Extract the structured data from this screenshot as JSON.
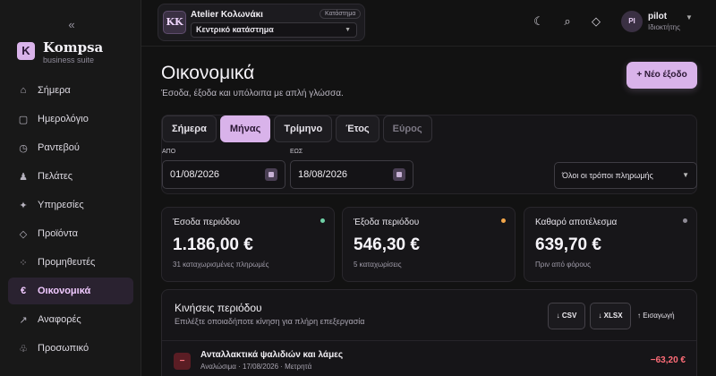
{
  "sidebar": {
    "collapse_glyph": "«",
    "brand": {
      "name": "Kompsa",
      "subtitle": "business suite",
      "logo_letter": "K"
    },
    "items": [
      {
        "label": "Σήμερα",
        "icon": "home-icon",
        "glyph": "⌂"
      },
      {
        "label": "Ημερολόγιο",
        "icon": "calendar-icon",
        "glyph": "▢"
      },
      {
        "label": "Ραντεβού",
        "icon": "clock-icon",
        "glyph": "◷"
      },
      {
        "label": "Πελάτες",
        "icon": "person-icon",
        "glyph": "♟"
      },
      {
        "label": "Υπηρεσίες",
        "icon": "sparkle-icon",
        "glyph": "✦"
      },
      {
        "label": "Προϊόντα",
        "icon": "diamond-icon",
        "glyph": "◇"
      },
      {
        "label": "Προμηθευτές",
        "icon": "dots-icon",
        "glyph": "⁘"
      },
      {
        "label": "Οικονομικά",
        "icon": "euro-icon",
        "glyph": "€",
        "active": true
      },
      {
        "label": "Αναφορές",
        "icon": "trend-arrow-icon",
        "glyph": "↗"
      },
      {
        "label": "Προσωπικό",
        "icon": "staff-icon",
        "glyph": "♧"
      }
    ]
  },
  "topbar": {
    "store": {
      "initials": "KK",
      "name": "Atelier Κολωνάκι",
      "tag": "Κατάστημα",
      "branch": "Κεντρικό κατάστημα"
    },
    "icons": [
      {
        "name": "theme-moon-icon",
        "glyph": "☾"
      },
      {
        "name": "search-icon",
        "glyph": "⌕"
      },
      {
        "name": "diamond-icon",
        "glyph": "◇"
      }
    ],
    "user": {
      "initials": "PI",
      "name": "pilot",
      "role": "Ιδιοκτήτης"
    }
  },
  "page": {
    "title": "Οικονομικά",
    "subtitle": "Έσοδα, έξοδα και υπόλοιπα με απλή γλώσσα.",
    "new_expense_label": "+ Νέο έξοδο"
  },
  "filters": {
    "tabs": [
      "Σήμερα",
      "Μήνας",
      "Τρίμηνο",
      "Έτος",
      "Εύρος"
    ],
    "active_tab": "Μήνας",
    "disabled_tab": "Εύρος",
    "from_label": "ΑΠΟ",
    "from_value": "01/08/2026",
    "to_label": "ΕΩΣ",
    "to_value": "18/08/2026",
    "payment_method": "Όλοι οι τρόποι πληρωμής"
  },
  "stats": [
    {
      "label": "Έσοδα περιόδου",
      "value": "1.186,00 €",
      "sub": "31 καταχωρισμένες πληρωμές",
      "dot_color": "#6fd0a6"
    },
    {
      "label": "Έξοδα περιόδου",
      "value": "546,30 €",
      "sub": "5 καταχωρίσεις",
      "dot_color": "#f2a64a"
    },
    {
      "label": "Καθαρό αποτέλεσμα",
      "value": "639,70 €",
      "sub": "Πριν από φόρους",
      "dot_color": "#8f8b96"
    }
  ],
  "movements": {
    "title": "Κινήσεις περιόδου",
    "subtitle": "Επιλέξτε οποιαδήποτε κίνηση για πλήρη επεξεργασία",
    "csv_label": "↓ CSV",
    "xlsx_label": "↓ XLSX",
    "import_label": "↑ Εισαγωγή",
    "rows": [
      {
        "icon_glyph": "−",
        "title": "Ανταλλακτικά ψαλιδιών και λάμες",
        "meta": "Αναλώσιμα · 17/08/2026 · Μετρητά",
        "amount": "−63,20 €"
      }
    ]
  }
}
